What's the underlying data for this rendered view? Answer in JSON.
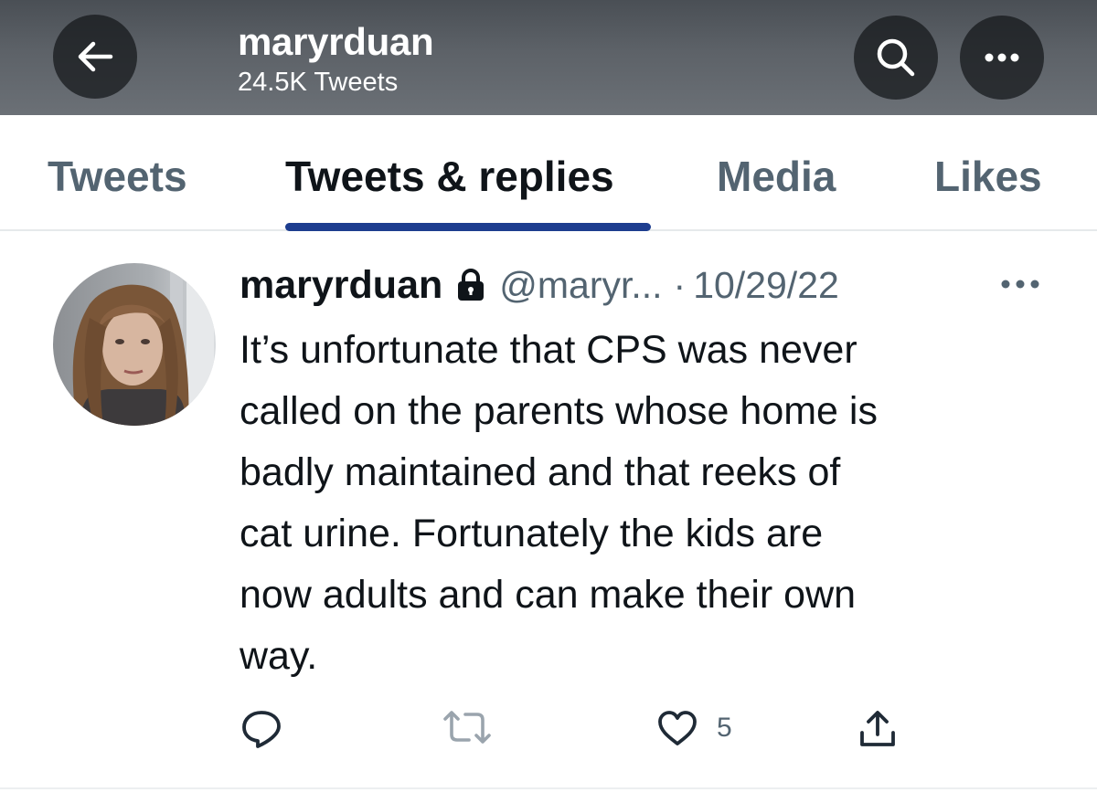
{
  "header": {
    "title": "maryrduan",
    "subtitle": "24.5K Tweets",
    "icons": {
      "back": "arrow-left-icon",
      "search": "search-icon",
      "more": "more-horizontal-icon"
    }
  },
  "tabs": [
    {
      "label": "Tweets",
      "active": false
    },
    {
      "label": "Tweets & replies",
      "active": true
    },
    {
      "label": "Media",
      "active": false
    },
    {
      "label": "Likes",
      "active": false
    }
  ],
  "tweet": {
    "author_name": "maryrduan",
    "protected_icon": "lock-icon",
    "handle": "@maryr...",
    "separator": "·",
    "date": "10/29/22",
    "text_lines": [
      "It’s unfortunate that CPS was never",
      "called on the parents whose home is",
      "badly maintained and that reeks of",
      "cat urine. Fortunately the kids are",
      "now adults and can make their own",
      "way."
    ],
    "actions": {
      "reply_icon": "reply-icon",
      "retweet_icon": "retweet-icon",
      "like_icon": "heart-icon",
      "like_count": "5",
      "share_icon": "share-icon"
    }
  },
  "colors": {
    "accent_underline": "#1d3d8f",
    "text_primary": "#0f1419",
    "text_secondary": "#536471",
    "header_bg": "#5d6268"
  }
}
